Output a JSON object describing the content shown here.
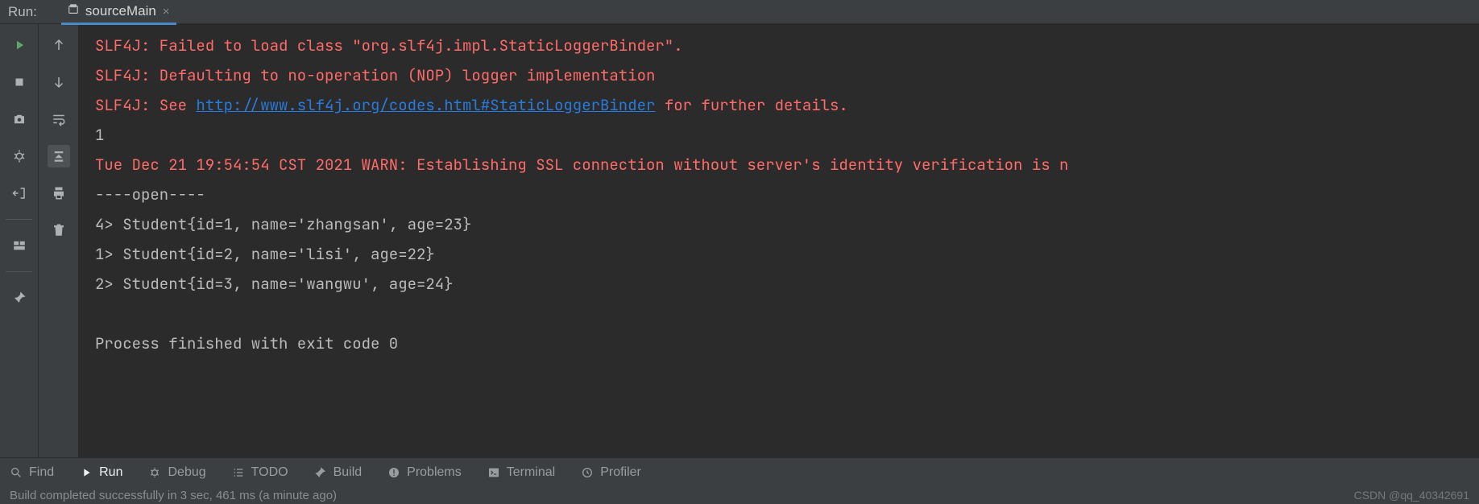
{
  "header": {
    "title": "Run:",
    "tab_name": "sourceMain"
  },
  "console": {
    "lines": [
      {
        "cls": "red",
        "text": "SLF4J: Failed to load class \"org.slf4j.impl.StaticLoggerBinder\"."
      },
      {
        "cls": "red",
        "text": "SLF4J: Defaulting to no-operation (NOP) logger implementation"
      },
      {
        "cls": "red",
        "prefix": "SLF4J: See ",
        "link": "http://www.slf4j.org/codes.html#StaticLoggerBinder",
        "suffix": " for further details."
      },
      {
        "cls": "white",
        "text": "1"
      },
      {
        "cls": "red",
        "text": "Tue Dec 21 19:54:54 CST 2021 WARN: Establishing SSL connection without server's identity verification is n"
      },
      {
        "cls": "white",
        "text": "----open----"
      },
      {
        "cls": "white",
        "text": "4> Student{id=1, name='zhangsan', age=23}"
      },
      {
        "cls": "white",
        "text": "1> Student{id=2, name='lisi', age=22}"
      },
      {
        "cls": "white",
        "text": "2> Student{id=3, name='wangwu', age=24}"
      },
      {
        "cls": "white",
        "text": ""
      },
      {
        "cls": "white",
        "text": "Process finished with exit code 0"
      }
    ]
  },
  "bottom": {
    "find": "Find",
    "run": "Run",
    "debug": "Debug",
    "todo": "TODO",
    "build": "Build",
    "problems": "Problems",
    "terminal": "Terminal",
    "profiler": "Profiler"
  },
  "status": {
    "message": "Build completed successfully in 3 sec, 461 ms (a minute ago)",
    "watermark": "CSDN @qq_40342691"
  }
}
